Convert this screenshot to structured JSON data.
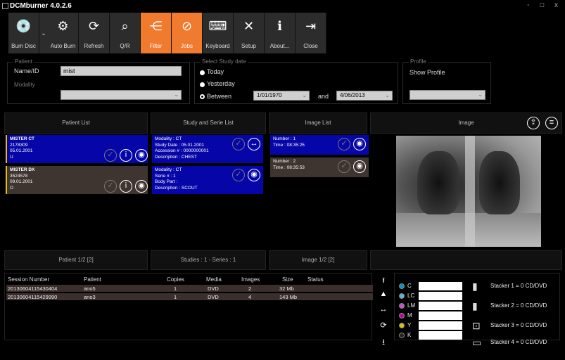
{
  "app": {
    "title": "DCMburner 4.0.2.6",
    "window_controls": "- □ x"
  },
  "toolbar": {
    "buttons": [
      {
        "label": "Burn Disc",
        "icon": "disc-icon",
        "glyph": "💿",
        "active": false
      },
      {
        "label": "Auto Burn",
        "icon": "gear-icon",
        "glyph": "⚙",
        "active": false
      },
      {
        "label": "Refresh",
        "icon": "refresh-icon",
        "glyph": "⟳",
        "active": false
      },
      {
        "label": "Q/R",
        "icon": "search-icon",
        "glyph": "⌕",
        "active": false
      },
      {
        "label": "Filter",
        "icon": "filter-icon",
        "glyph": "⋲",
        "active": true
      },
      {
        "label": "Jobs",
        "icon": "jobs-icon",
        "glyph": "⊘",
        "active": true
      },
      {
        "label": "Keyboard",
        "icon": "keyboard-icon",
        "glyph": "⌨",
        "active": false
      },
      {
        "label": "Setup",
        "icon": "tools-icon",
        "glyph": "✕",
        "active": false
      },
      {
        "label": "About...",
        "icon": "info-icon",
        "glyph": "ℹ",
        "active": false
      },
      {
        "label": "Close",
        "icon": "exit-icon",
        "glyph": "⇥",
        "active": false
      }
    ],
    "dropdown_glyph": "⌄"
  },
  "filter": {
    "patient_group": "Patient",
    "name_label": "Name/ID",
    "name_value": "mist",
    "modality_label": "Modality",
    "modality_value": "",
    "study_date_group": "Select Study date",
    "radio_today": "Today",
    "radio_yesterday": "Yesterday",
    "radio_between": "Between",
    "date_from": "1/01/1970",
    "and_label": "and",
    "date_to": "4/06/2013",
    "profile_group": "Profile",
    "show_profile": "Show Profile",
    "profile_value": ""
  },
  "headers": {
    "patient_list": "Patient List",
    "study_list": "Study and Serie List",
    "image_list": "Image List",
    "image": "Image"
  },
  "patients": [
    {
      "name": "MISTER CT",
      "id": "2178309",
      "date": "05.01.2001",
      "sex": "U"
    },
    {
      "name": "MISTER DX",
      "id": "3524578",
      "date": "09.01.2001",
      "sex": "O"
    }
  ],
  "studies": [
    {
      "l1": "Modality : CT",
      "l2": "Study Date : 05.01.2001",
      "l3": "Accession # : 0000000001",
      "l4": "Description : CHEST"
    },
    {
      "l1": "Modality : CT",
      "l2": "Serie # : 1",
      "l3": "Body Part :",
      "l4": "Description : SCOUT"
    }
  ],
  "images": [
    {
      "l1": "Number : 1",
      "l2": "Time : 08:35:25"
    },
    {
      "l1": "Number : 2",
      "l2": "Time : 08:35:53"
    }
  ],
  "summary": {
    "patients": "Patient 1/2 [2]",
    "studies": "Studies : 1 - Series : 1",
    "images": "Image 1/2 [2]"
  },
  "jobs": {
    "columns": [
      "Session Number",
      "Patient",
      "Copies",
      "Media",
      "Images",
      "Size",
      "Status"
    ],
    "rows": [
      {
        "session": "20130604115430404",
        "patient": "ano5",
        "copies": "1",
        "media": "DVD",
        "images": "2",
        "size": "32 Mb",
        "status": ""
      },
      {
        "session": "20130604115429990",
        "patient": "ano3",
        "copies": "1",
        "media": "DVD",
        "images": "4",
        "size": "143 Mb",
        "status": ""
      }
    ]
  },
  "inks": [
    {
      "label": "C",
      "color": "#0096c8"
    },
    {
      "label": "LC",
      "color": "#5ab4dc"
    },
    {
      "label": "LM",
      "color": "#c850c8"
    },
    {
      "label": "M",
      "color": "#c800a0"
    },
    {
      "label": "Y",
      "color": "#d4c800"
    },
    {
      "label": "K",
      "color": "#222222"
    }
  ],
  "stackers": [
    "Stacker 1 = 0 CD/DVD",
    "Stacker 2 = 0 CD/DVD",
    "Stacker 3 = 0 CD/DVD",
    "Stacker 4 = 0 CD/DVD"
  ],
  "colors": {
    "accent": "#f07a2e",
    "selected_card": "#0606a8",
    "card": "#3e3430"
  }
}
